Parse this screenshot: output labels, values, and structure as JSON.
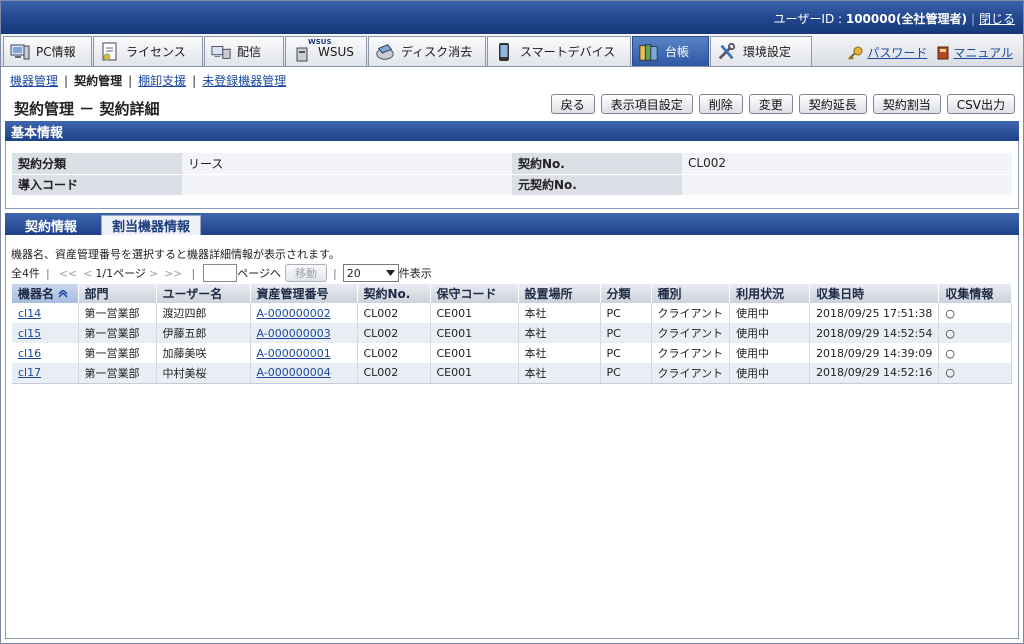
{
  "header": {
    "user_label": "ユーザーID : ",
    "user_value": "100000(全社管理者)",
    "close_label": "閉じる"
  },
  "main_tabs": [
    {
      "label": "PC情報",
      "icon": "pc-icon"
    },
    {
      "label": "ライセンス",
      "icon": "license-icon"
    },
    {
      "label": "配信",
      "icon": "delivery-icon"
    },
    {
      "label": "WSUS",
      "icon": "wsus-icon",
      "badge": "WSUS"
    },
    {
      "label": "ディスク消去",
      "icon": "disk-erase-icon"
    },
    {
      "label": "スマートデバイス",
      "icon": "smartphone-icon"
    },
    {
      "label": "台帳",
      "icon": "ledger-icon",
      "active": true
    },
    {
      "label": "環境設定",
      "icon": "tools-icon"
    }
  ],
  "tab_links": {
    "password": "パスワード",
    "manual": "マニュアル"
  },
  "subnav": {
    "items": [
      "機器管理",
      "契約管理",
      "棚卸支援",
      "未登録機器管理"
    ],
    "current_index": 1
  },
  "page_title": "契約管理 － 契約詳細",
  "actions": [
    "戻る",
    "表示項目設定",
    "削除",
    "変更",
    "契約延長",
    "契約割当",
    "CSV出力"
  ],
  "basic_info": {
    "section_title": "基本情報",
    "rows": [
      {
        "k1": "契約分類",
        "v1": "リース",
        "k2": "契約No.",
        "v2": "CL002"
      },
      {
        "k1": "導入コード",
        "v1": "",
        "k2": "元契約No.",
        "v2": ""
      }
    ]
  },
  "sub_tabs": {
    "contract_info": "契約情報",
    "assigned_devices": "割当機器情報"
  },
  "list": {
    "hint": "機器名、資産管理番号を選択すると機器詳細情報が表示されます。",
    "total": "全4件",
    "first": "<<",
    "prev": "<",
    "page_info": "1/1ページ",
    "next": ">",
    "last": ">>",
    "goto_label": "ページへ",
    "move_button": "移動",
    "per_page_value": "20",
    "per_page_suffix": "件表示",
    "columns": [
      "機器名",
      "部門",
      "ユーザー名",
      "資産管理番号",
      "契約No.",
      "保守コード",
      "設置場所",
      "分類",
      "種別",
      "利用状況",
      "収集日時",
      "収集情報"
    ],
    "rows": [
      [
        "cl14",
        "第一営業部",
        "渡辺四郎",
        "A-000000002",
        "CL002",
        "CE001",
        "本社",
        "PC",
        "クライアント",
        "使用中",
        "2018/09/25 17:51:38",
        "○"
      ],
      [
        "cl15",
        "第一営業部",
        "伊藤五郎",
        "A-000000003",
        "CL002",
        "CE001",
        "本社",
        "PC",
        "クライアント",
        "使用中",
        "2018/09/29 14:52:54",
        "○"
      ],
      [
        "cl16",
        "第一営業部",
        "加藤美咲",
        "A-000000001",
        "CL002",
        "CE001",
        "本社",
        "PC",
        "クライアント",
        "使用中",
        "2018/09/29 14:39:09",
        "○"
      ],
      [
        "cl17",
        "第一営業部",
        "中村美桜",
        "A-000000004",
        "CL002",
        "CE001",
        "本社",
        "PC",
        "クライアント",
        "使用中",
        "2018/09/29 14:52:16",
        "○"
      ]
    ]
  }
}
